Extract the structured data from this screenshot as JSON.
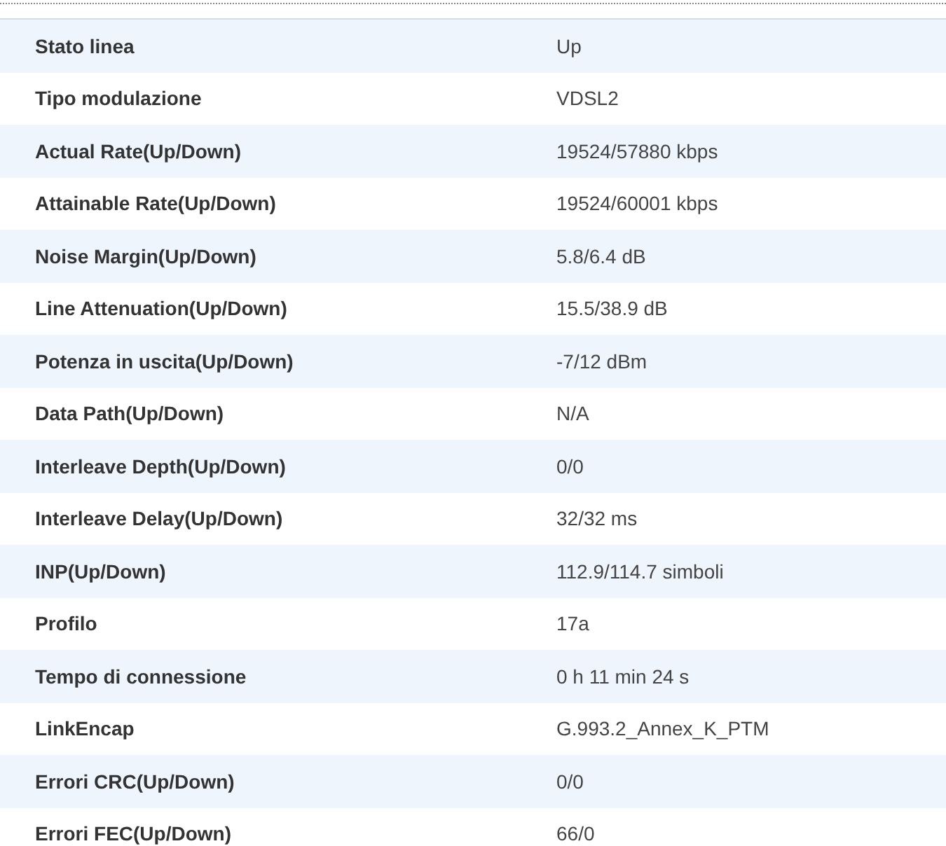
{
  "rows": [
    {
      "label": "Stato linea",
      "value": "Up"
    },
    {
      "label": "Tipo modulazione",
      "value": "VDSL2"
    },
    {
      "label": "Actual Rate(Up/Down)",
      "value": "19524/57880 kbps"
    },
    {
      "label": "Attainable Rate(Up/Down)",
      "value": "19524/60001 kbps"
    },
    {
      "label": "Noise Margin(Up/Down)",
      "value": "5.8/6.4 dB"
    },
    {
      "label": "Line Attenuation(Up/Down)",
      "value": "15.5/38.9 dB"
    },
    {
      "label": "Potenza in uscita(Up/Down)",
      "value": "-7/12 dBm"
    },
    {
      "label": "Data Path(Up/Down)",
      "value": "N/A"
    },
    {
      "label": "Interleave Depth(Up/Down)",
      "value": "0/0"
    },
    {
      "label": "Interleave Delay(Up/Down)",
      "value": "32/32 ms"
    },
    {
      "label": "INP(Up/Down)",
      "value": "112.9/114.7 simboli"
    },
    {
      "label": "Profilo",
      "value": "17a"
    },
    {
      "label": "Tempo di connessione",
      "value": "0 h 11 min 24 s"
    },
    {
      "label": "LinkEncap",
      "value": "G.993.2_Annex_K_PTM"
    },
    {
      "label": "Errori CRC(Up/Down)",
      "value": "0/0"
    },
    {
      "label": "Errori FEC(Up/Down)",
      "value": "66/0"
    }
  ]
}
